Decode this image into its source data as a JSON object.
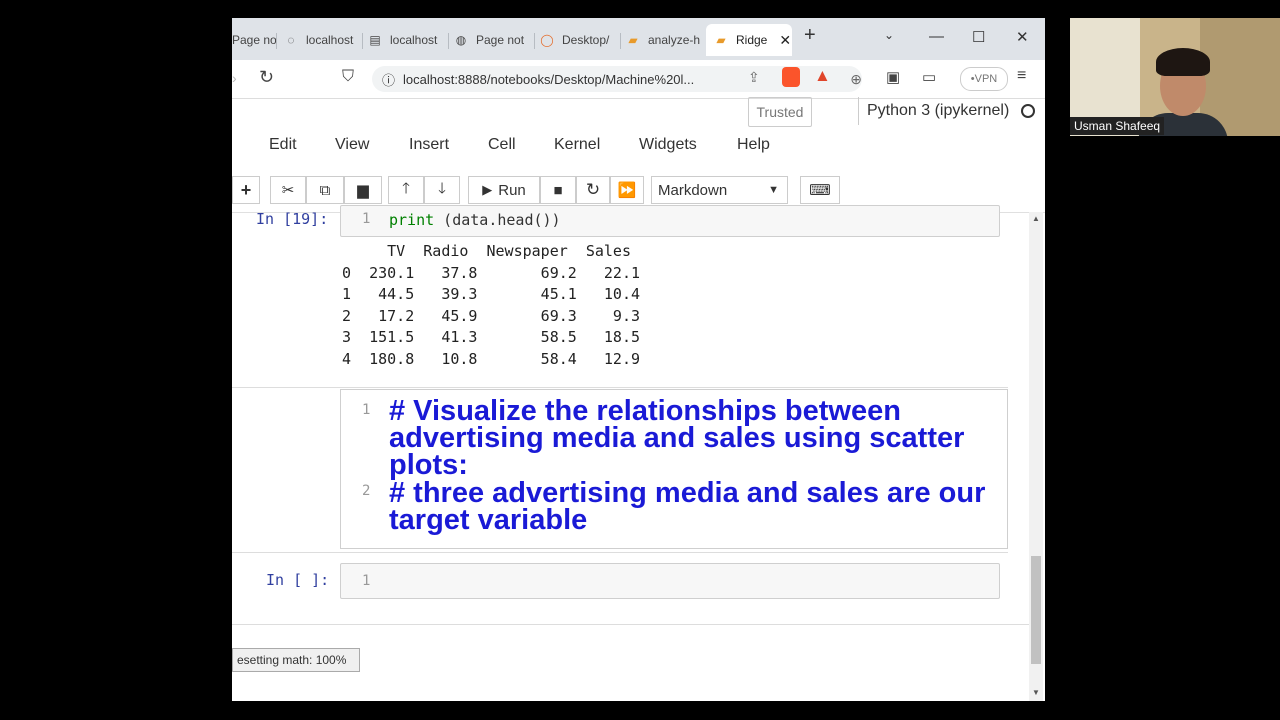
{
  "browser": {
    "tabs": [
      {
        "label": "Page not f",
        "icon": "page-icon"
      },
      {
        "label": "localhost",
        "icon": "loading-icon"
      },
      {
        "label": "localhost",
        "icon": "page-icon"
      },
      {
        "label": "Page not",
        "icon": "globe-icon"
      },
      {
        "label": "Desktop/",
        "icon": "jupyter-icon"
      },
      {
        "label": "analyze-h",
        "icon": "notebook-icon"
      },
      {
        "label": "Ridge",
        "icon": "notebook-icon"
      }
    ],
    "url": "localhost:8888/notebooks/Desktop/Machine%20l...",
    "vpn_label": "VPN"
  },
  "jupyter": {
    "trusted_label": "Trusted",
    "kernel_label": "Python 3 (ipykernel)",
    "menus": [
      "Edit",
      "View",
      "Insert",
      "Cell",
      "Kernel",
      "Widgets",
      "Help"
    ],
    "run_label": "Run",
    "cell_type": "Markdown"
  },
  "cells": {
    "cell1": {
      "prompt": "In [19]:",
      "line_no": "1",
      "code_kw": "print",
      "code_rest": " (data.head())",
      "output_rows": [
        "     TV  Radio  Newspaper  Sales",
        "0  230.1   37.8       69.2   22.1",
        "1   44.5   39.3       45.1   10.4",
        "2   17.2   45.9       69.3    9.3",
        "3  151.5   41.3       58.5   18.5",
        "4  180.8   10.8       58.4   12.9"
      ]
    },
    "cell2": {
      "line1_no": "1",
      "line1_text": "# Visualize the relationships between advertising media and sales using scatter plots:",
      "line2_no": "2",
      "line2_text": "# three advertising media and sales are our target variable"
    },
    "cell3": {
      "prompt": "In [ ]:",
      "line_no": "1"
    }
  },
  "status_text": "esetting math: 100%",
  "webcam": {
    "name": "Usman Shafeeq"
  }
}
